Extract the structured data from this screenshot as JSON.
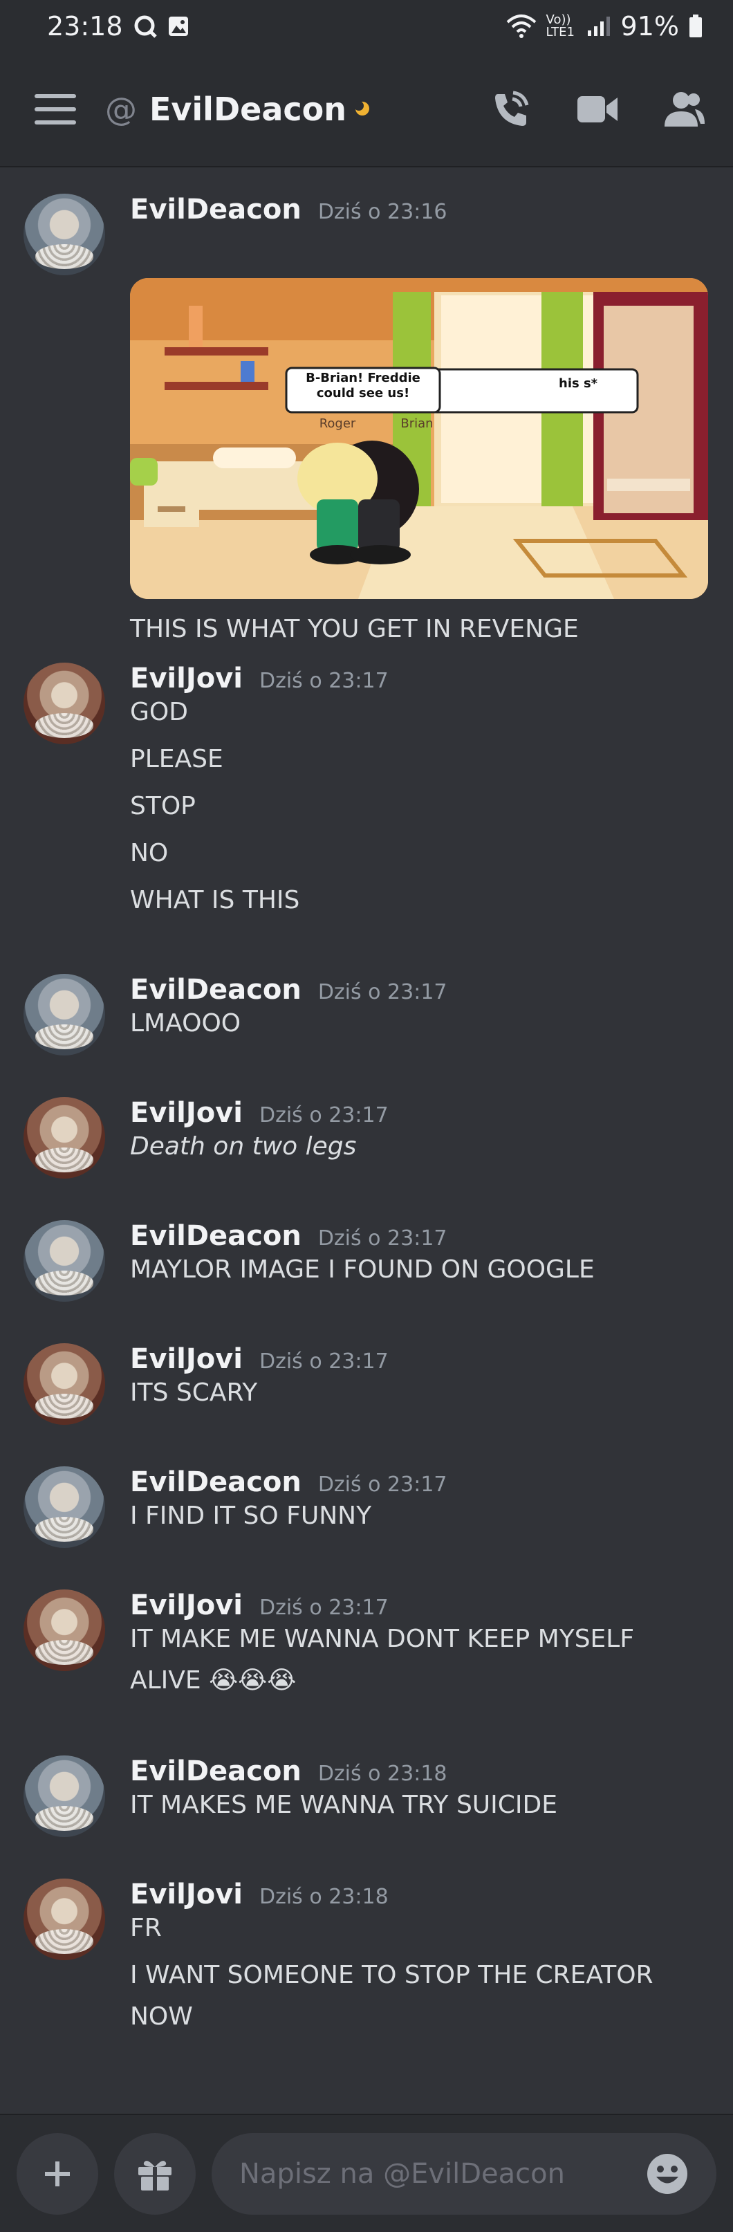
{
  "status_bar": {
    "time": "23:18",
    "network_label": "Vo)) LTE1",
    "battery": "91%"
  },
  "header": {
    "title": "EvilDeacon",
    "at_symbol": "@"
  },
  "messages": [
    {
      "author": "EvilDeacon",
      "time": "Dziś o 23:16",
      "lines": [
        "THIS IS WHAT YOU GET IN REVENGE"
      ],
      "attachment": {
        "speech_bubble": "B-Brian! Freddie could see us!",
        "speech_bubble_back": "his s*",
        "name_left": "Roger",
        "name_right": "Brian"
      }
    },
    {
      "author": "EvilJovi",
      "time": "Dziś o 23:17",
      "lines": [
        "GOD",
        "PLEASE",
        "STOP",
        "NO",
        "WHAT IS THIS"
      ]
    },
    {
      "author": "EvilDeacon",
      "time": "Dziś o 23:17",
      "lines": [
        "LMAOOO"
      ]
    },
    {
      "author": "EvilJovi",
      "time": "Dziś o 23:17",
      "lines": [
        "Death on two legs"
      ]
    },
    {
      "author": "EvilDeacon",
      "time": "Dziś o 23:17",
      "lines": [
        "MAYLOR IMAGE I FOUND ON GOOGLE"
      ]
    },
    {
      "author": "EvilJovi",
      "time": "Dziś o 23:17",
      "lines": [
        "ITS SCARY"
      ]
    },
    {
      "author": "EvilDeacon",
      "time": "Dziś o 23:17",
      "lines": [
        "I FIND IT SO FUNNY"
      ]
    },
    {
      "author": "EvilJovi",
      "time": "Dziś o 23:17",
      "lines": [
        "IT MAKE ME WANNA DONT KEEP MYSELF",
        "ALIVE 😭😭😭"
      ]
    },
    {
      "author": "EvilDeacon",
      "time": "Dziś o 23:18",
      "lines": [
        "IT MAKES ME WANNA TRY SUICIDE"
      ]
    },
    {
      "author": "EvilJovi",
      "time": "Dziś o 23:18",
      "lines": [
        "FR",
        "I WANT SOMEONE TO STOP THE CREATOR",
        "NOW"
      ]
    }
  ],
  "composer": {
    "placeholder": "Napisz na @EvilDeacon"
  },
  "colors": {
    "background": "#313338",
    "bars": "#2b2d31",
    "idle_status": "#f0b232"
  }
}
